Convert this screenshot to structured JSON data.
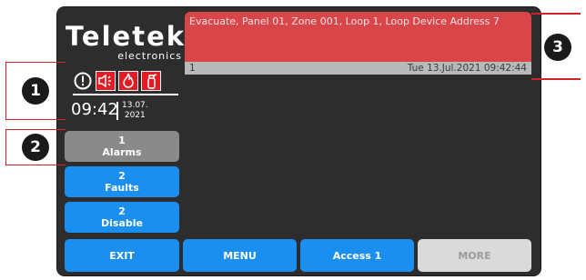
{
  "brand": {
    "name": "Teletek",
    "sub": "electronics"
  },
  "status_icons": [
    "warning-icon",
    "siren-icon",
    "fire-icon",
    "extinguisher-icon"
  ],
  "clock": {
    "time": "09:42",
    "date_line1": "13.07.",
    "date_line2": "2021"
  },
  "side_buttons": [
    {
      "count": "1",
      "label": "Alarms"
    },
    {
      "count": "2",
      "label": "Faults"
    },
    {
      "count": "2",
      "label": "Disable"
    }
  ],
  "event": {
    "text": "Evacuate, Panel 01, Zone 001, Loop 1, Loop Device Address 7",
    "index": "1",
    "timestamp": "Tue 13.Jul.2021 09:42:44"
  },
  "bottom_buttons": {
    "exit": "EXIT",
    "menu": "MENU",
    "access": "Access 1",
    "more": "MORE"
  },
  "callouts": [
    "1",
    "2",
    "3"
  ],
  "colors": {
    "panel": "#2d2d2d",
    "alarm_red": "#d9464a",
    "button_blue": "#1a8ff0",
    "callout_red": "#d1232a"
  }
}
